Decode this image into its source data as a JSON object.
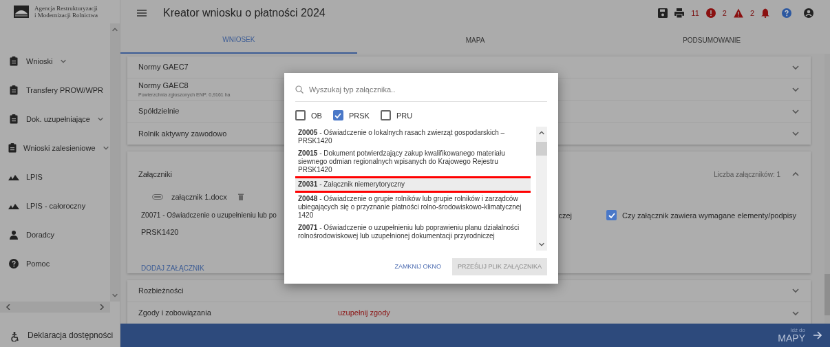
{
  "logo": {
    "line1": "Agencja Restrukturyzacji",
    "line2": "i Modernizacji Rolnictwa"
  },
  "header": {
    "title": "Kreator wniosku o płatności 2024",
    "errors": "11",
    "warnings": "2",
    "notifications": "2"
  },
  "sidebar": {
    "items": [
      {
        "label": "Wnioski",
        "kind": "document",
        "expandable": true
      },
      {
        "label": "Transfery PROW/WPR",
        "kind": "document",
        "expandable": false
      },
      {
        "label": "Dok. uzupełniające",
        "kind": "document",
        "expandable": true
      },
      {
        "label": "Wnioski zalesieniowe",
        "kind": "document",
        "expandable": true
      },
      {
        "label": "LPIS",
        "kind": "map",
        "expandable": false
      },
      {
        "label": "LPIS - całoroczny",
        "kind": "map",
        "expandable": false
      },
      {
        "label": "Doradcy",
        "kind": "people",
        "expandable": false
      },
      {
        "label": "Pomoc",
        "kind": "support",
        "expandable": false
      }
    ],
    "footer": "Deklaracja dostępności"
  },
  "tabs": [
    {
      "label": "WNIOSEK",
      "selected": true
    },
    {
      "label": "MAPA",
      "selected": false
    },
    {
      "label": "PODSUMOWANIE",
      "selected": false
    }
  ],
  "sections_top": [
    {
      "title": "Normy GAEC7"
    },
    {
      "title": "Normy GAEC8",
      "subtitle": "Powierzchnia zgłoszonych ENP: 0,9161 ha"
    },
    {
      "title": "Spółdzielnie"
    },
    {
      "title": "Rolnik aktywny zawodowo"
    }
  ],
  "attachments": {
    "title": "Załączniki",
    "count": "Liczba załączników: 1",
    "file": "załącznik 1.docx",
    "type": "Z0071 - Oświadczenie o uzupełnieniu lub po",
    "type_tail": "czej",
    "type_code": "PRSK1420",
    "confirm": {
      "label": "Czy załącznik zawiera wymagane elementy/podpisy",
      "checked": true
    },
    "add": "DODAJ ZAŁĄCZNIK"
  },
  "sections_bottom": [
    {
      "title": "Rozbieżności"
    },
    {
      "title": "Zgody i zobowiązania",
      "warning": "uzupełnij zgody"
    }
  ],
  "footer_bar": {
    "small": "Idź do",
    "big": "MAPY"
  },
  "dialog": {
    "search": {
      "placeholder": "Wyszukaj typ załącznika.."
    },
    "filters": [
      {
        "label": "OB",
        "checked": false
      },
      {
        "label": "PRSK",
        "checked": true
      },
      {
        "label": "PRU",
        "checked": false
      }
    ],
    "options": [
      {
        "code": "Z0005",
        "text": " - Oświadczenie o lokalnych rasach zwierząt gospodarskich – PRSK1420",
        "highlighted": false
      },
      {
        "code": "Z0015",
        "text": " - Dokument potwierdzający zakup kwalifikowanego materiału siewnego odmian regionalnych wpisanych do Krajowego Rejestru PRSK1420",
        "highlighted": false
      },
      {
        "code": "Z0031",
        "text": " - Załącznik niemerytoryczny",
        "highlighted": true
      },
      {
        "code": "Z0048",
        "text": " - Oświadczenie o grupie rolników lub grupie rolników i zarządców ubiegających się o przyznanie płatności rolno-środowiskowo-klimatycznej 1420",
        "highlighted": false
      },
      {
        "code": "Z0071",
        "text": " - Oświadczenie o uzupełnieniu lub poprawieniu planu działalności rolnośrodowiskowej lub uzupełnionej dokumentacji przyrodniczej",
        "highlighted": false
      }
    ],
    "buttons": [
      {
        "label": "ZAMKNIJ OKNO",
        "disabled": false
      },
      {
        "label": "PRZEŚLIJ PLIK ZAŁĄCZNIKA",
        "disabled": true
      }
    ]
  }
}
